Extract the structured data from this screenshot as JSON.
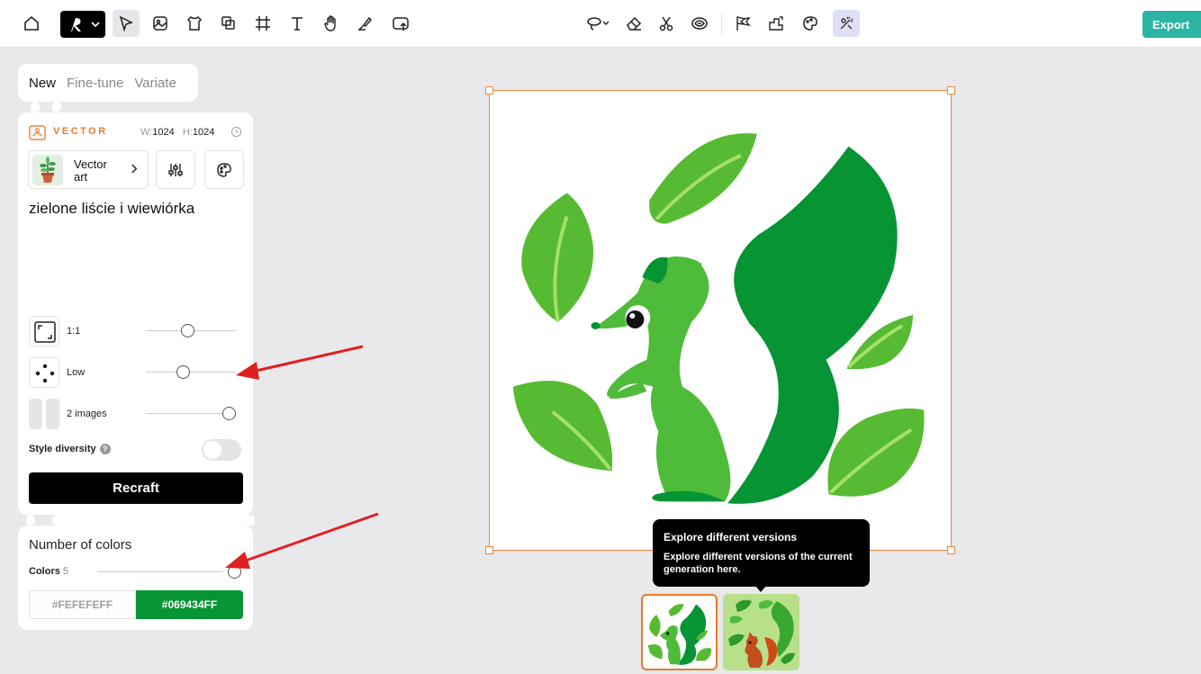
{
  "toolbar": {
    "left_tools": [
      "home-icon",
      "logo-menu",
      "select-tool",
      "image-tool",
      "mockup-tool",
      "layers-tool",
      "frame-tool",
      "text-tool",
      "hand-tool",
      "pen-tool",
      "upload-tool"
    ],
    "center_tools": [
      "lasso-tool",
      "eraser-tool",
      "scissors-tool",
      "vectorize-tool",
      "flags-tool",
      "upscale-tool",
      "palette-tool",
      "explore-tool"
    ],
    "export_label": "Export",
    "accent": "#2ab4a4"
  },
  "panel": {
    "tabs": [
      "New",
      "Fine-tune",
      "Variate"
    ],
    "mode_label": "VECTOR",
    "width_prefix": "W:",
    "width_value": "1024",
    "height_prefix": "H:",
    "height_value": "1024",
    "style_name": "Vector art",
    "prompt": "zielone liście i wiewiórka",
    "ratio_label": "1:1",
    "detail_label": "Low",
    "images_label": "2 images",
    "style_diversity_label": "Style diversity",
    "style_diversity_on": false,
    "recraft_label": "Recraft"
  },
  "colors": {
    "title": "Number of colors",
    "label": "Colors",
    "count": "5",
    "swatches": [
      {
        "hex": "#FEFEFEFF",
        "bg": "#fefefe",
        "text": "#a0a0a0"
      },
      {
        "hex": "#069434FF",
        "bg": "#069434",
        "text": "#ffffff"
      }
    ]
  },
  "canvas": {
    "selection_color": "#e8893a"
  },
  "tooltip": {
    "title": "Explore different versions",
    "body": "Explore different versions of the current generation here."
  },
  "annotations": {
    "arrow_color": "#e02020"
  }
}
